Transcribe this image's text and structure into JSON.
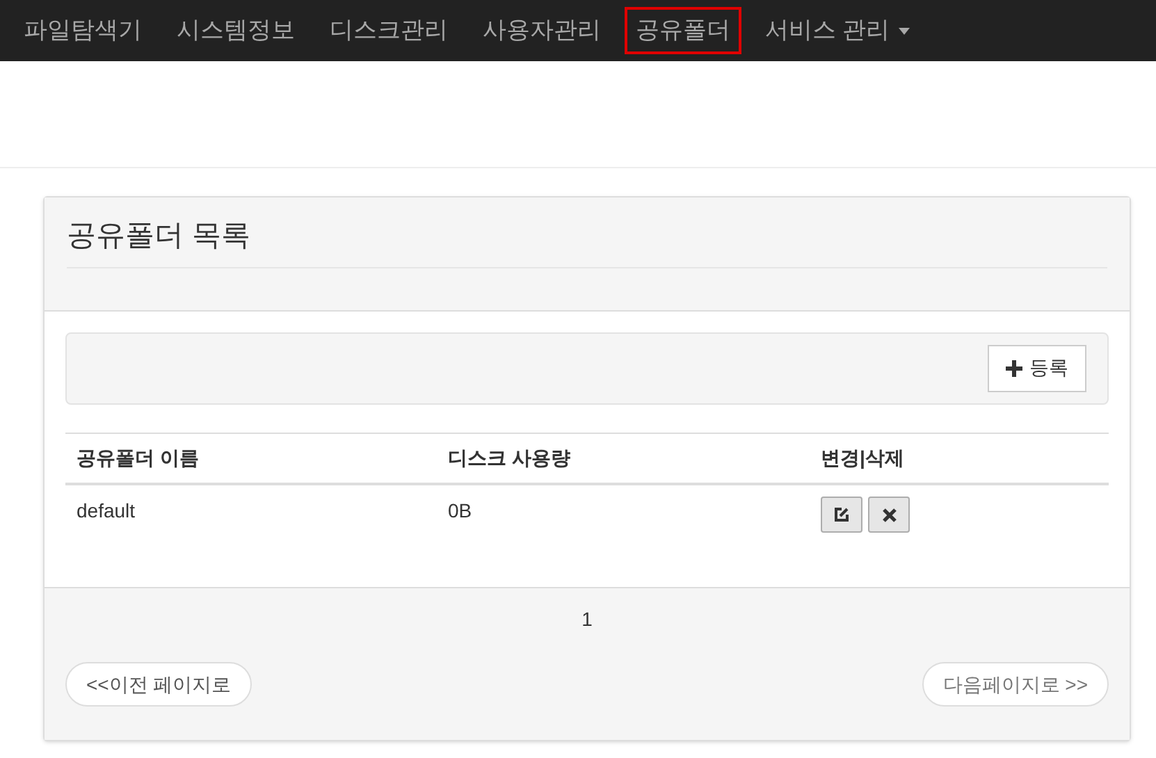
{
  "navbar": {
    "items": [
      {
        "label": "파일탐색기",
        "selected": false,
        "has_menu": false
      },
      {
        "label": "시스템정보",
        "selected": false,
        "has_menu": false
      },
      {
        "label": "디스크관리",
        "selected": false,
        "has_menu": false
      },
      {
        "label": "사용자관리",
        "selected": false,
        "has_menu": false
      },
      {
        "label": "공유폴더",
        "selected": true,
        "has_menu": false
      },
      {
        "label": "서비스 관리",
        "selected": false,
        "has_menu": true
      }
    ]
  },
  "panel": {
    "title": "공유폴더 목록",
    "add_button": "등록",
    "table": {
      "columns": [
        "공유폴더 이름",
        "디스크 사용량",
        "변경|삭제"
      ],
      "rows": [
        {
          "name": "default",
          "usage": "0B"
        }
      ]
    },
    "pagination": {
      "current_page": "1",
      "prev_button": "<<이전 페이지로",
      "next_button": "다음페이지로 >>"
    }
  }
}
